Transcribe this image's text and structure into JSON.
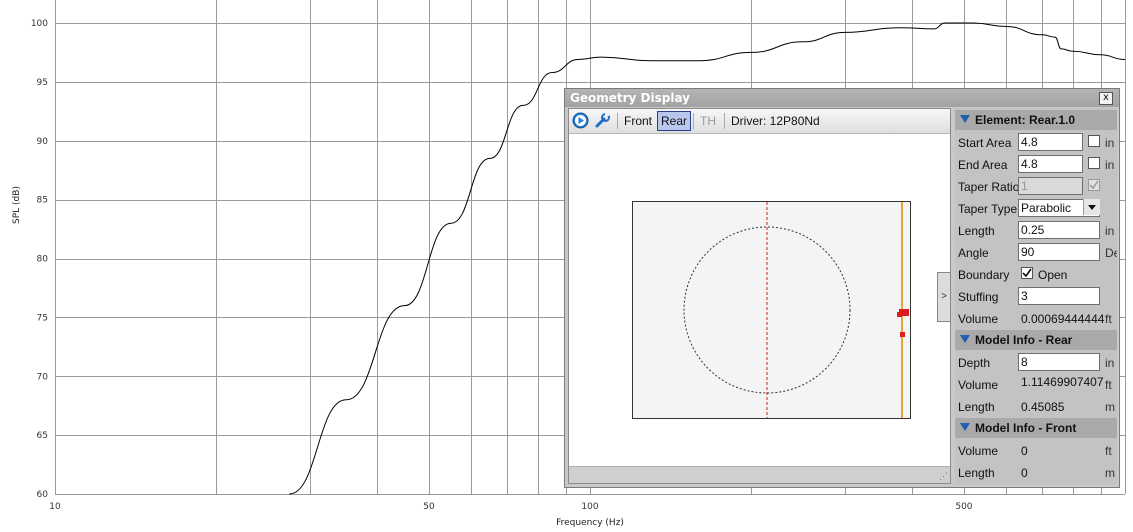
{
  "chart_data": {
    "type": "line",
    "title": "",
    "xlabel": "Frequency (Hz)",
    "ylabel": "SPL (dB)",
    "x_scale": "log",
    "xlim": [
      10,
      1000
    ],
    "ylim": [
      60,
      100
    ],
    "grid": true,
    "x_tick_labels": [
      {
        "value": 10,
        "label": "10"
      },
      {
        "value": 50,
        "label": "50"
      },
      {
        "value": 100,
        "label": "100"
      },
      {
        "value": 500,
        "label": "500"
      }
    ],
    "y_ticks": [
      60,
      65,
      70,
      75,
      80,
      85,
      90,
      95,
      100
    ],
    "series": [
      {
        "color": "#000000",
        "x": [
          27.4,
          35,
          45,
          55,
          65,
          75,
          85,
          95,
          105,
          130,
          160,
          200,
          250,
          300,
          380,
          440,
          460,
          480,
          520,
          600,
          700,
          740,
          760,
          800,
          900,
          1000
        ],
        "y": [
          60,
          68,
          76,
          83,
          88.5,
          93,
          95.8,
          96.9,
          97.1,
          96.8,
          96.8,
          97.5,
          98.4,
          99.2,
          99.6,
          99.5,
          100,
          100,
          100,
          99.7,
          99,
          98.8,
          97.8,
          97.6,
          97.3,
          96.9
        ]
      }
    ]
  },
  "geometry_window": {
    "title": "Geometry Display",
    "close_glyph": "x",
    "toolbar": {
      "front_label": "Front",
      "rear_label": "Rear",
      "th_label": "TH",
      "driver_label": "Driver: 12P80Nd"
    },
    "expand_glyph": ">",
    "grip_glyph": "⋰"
  },
  "element_section": {
    "title": "Element: Rear.1.0",
    "start_area": {
      "label": "Start Area",
      "value": "4.8",
      "unit": "in"
    },
    "end_area": {
      "label": "End Area",
      "value": "4.8",
      "unit": "in"
    },
    "taper_ratio": {
      "label": "Taper Ratio",
      "value": "1"
    },
    "taper_type": {
      "label": "Taper Type",
      "value": "Parabolic"
    },
    "length": {
      "label": "Length",
      "value": "0.25",
      "unit": "in"
    },
    "angle": {
      "label": "Angle",
      "value": "90",
      "unit": "De"
    },
    "boundary": {
      "label": "Boundary",
      "checkbox_label": "Open",
      "checked": true
    },
    "stuffing": {
      "label": "Stuffing",
      "value": "3"
    },
    "volume": {
      "label": "Volume",
      "value": "0.00069444444",
      "unit": "ft"
    }
  },
  "model_rear_section": {
    "title": "Model Info - Rear",
    "depth": {
      "label": "Depth",
      "value": "8",
      "unit": "in"
    },
    "volume": {
      "label": "Volume",
      "value": "1.11469907407",
      "unit": "ft"
    },
    "length": {
      "label": "Length",
      "value": "0.45085",
      "unit": "m"
    }
  },
  "model_front_section": {
    "title": "Model Info - Front",
    "volume": {
      "label": "Volume",
      "value": "0",
      "unit": "ft"
    },
    "length": {
      "label": "Length",
      "value": "0",
      "unit": "m"
    }
  }
}
